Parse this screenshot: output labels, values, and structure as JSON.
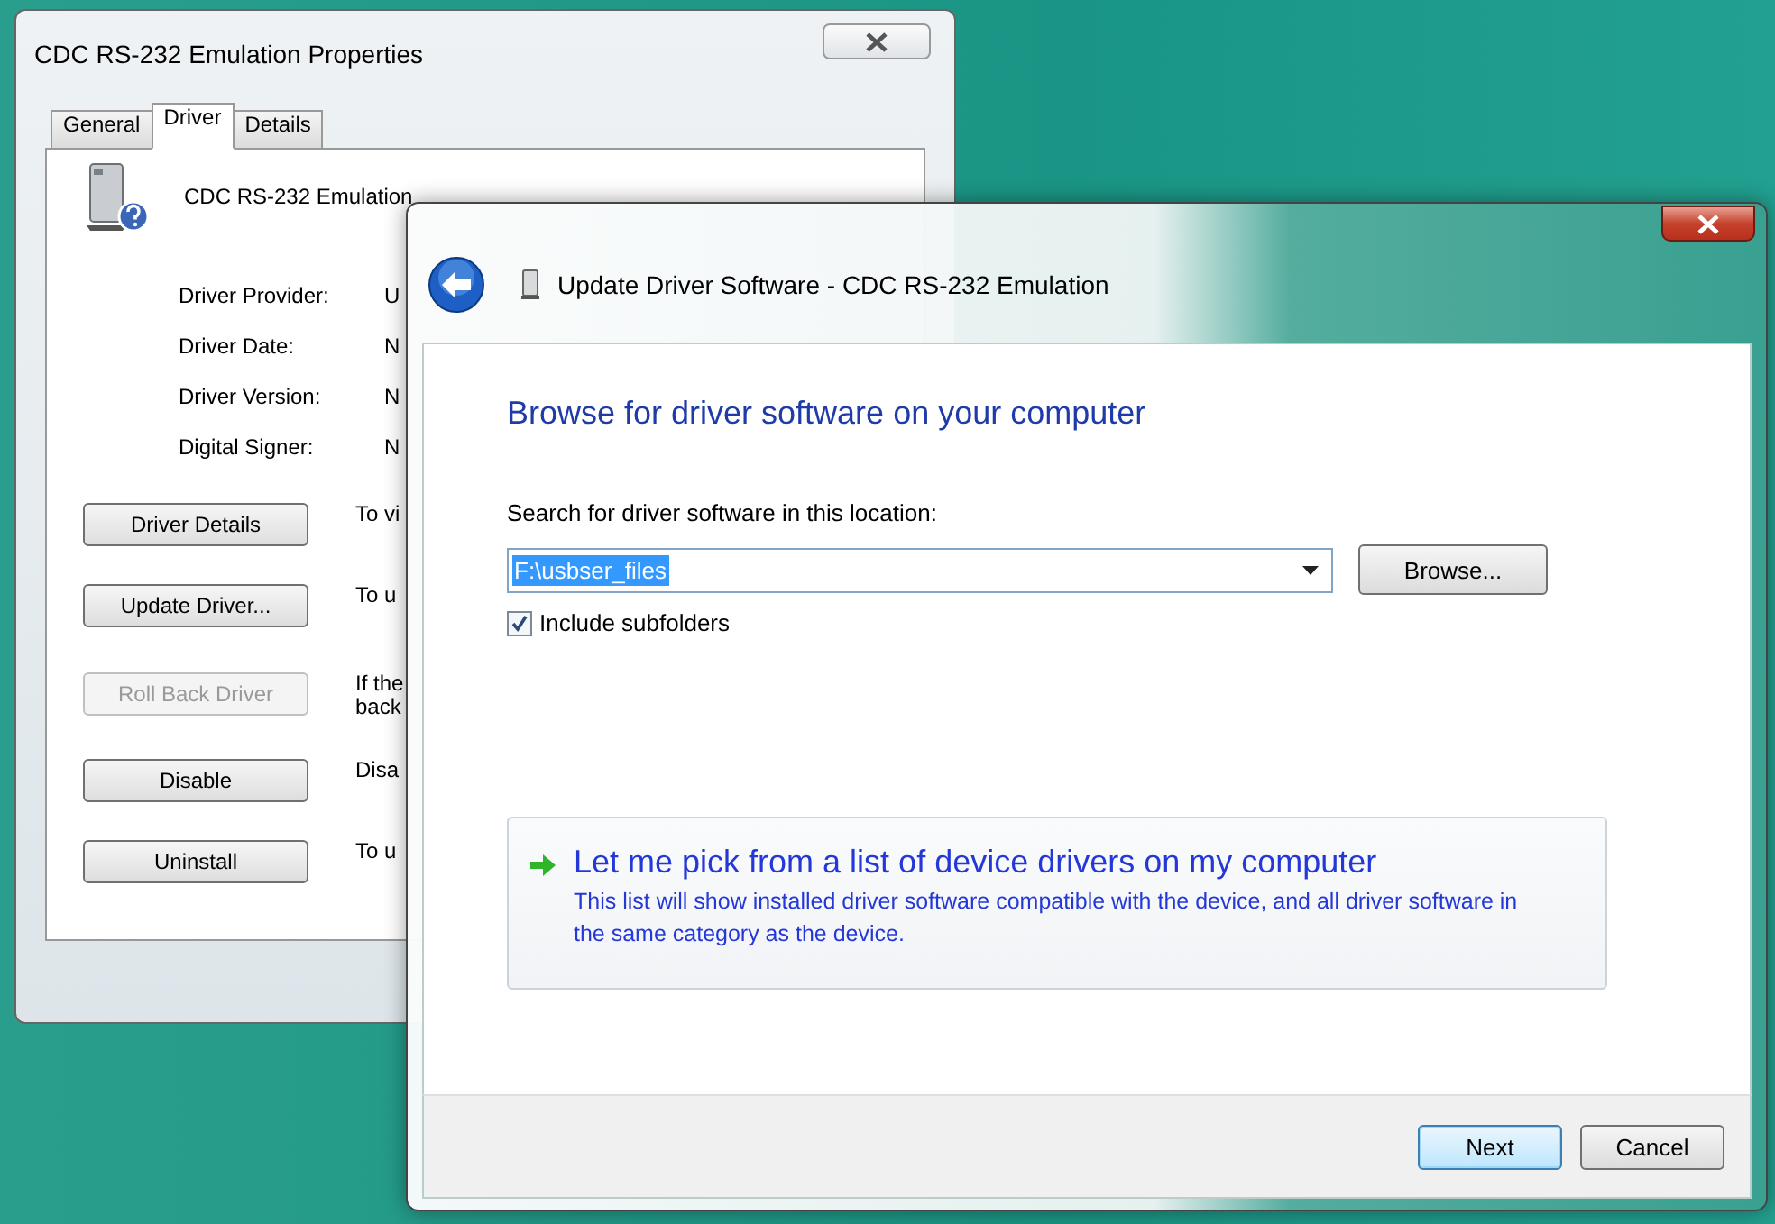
{
  "properties_window": {
    "title": "CDC RS-232 Emulation Properties",
    "tabs": [
      {
        "label": "General",
        "selected": false
      },
      {
        "label": "Driver",
        "selected": true
      },
      {
        "label": "Details",
        "selected": false
      }
    ],
    "device_name": "CDC RS-232 Emulation",
    "fields": [
      {
        "label": "Driver Provider:",
        "value": "U"
      },
      {
        "label": "Driver Date:",
        "value": "N"
      },
      {
        "label": "Driver Version:",
        "value": "N"
      },
      {
        "label": "Digital Signer:",
        "value": "N"
      }
    ],
    "actions": [
      {
        "button": "Driver Details",
        "disabled": false,
        "description_lines": [
          "To vi"
        ]
      },
      {
        "button": "Update Driver...",
        "disabled": false,
        "description_lines": [
          "To u"
        ]
      },
      {
        "button": "Roll Back Driver",
        "disabled": true,
        "description_lines": [
          "If the",
          "back"
        ]
      },
      {
        "button": "Disable",
        "disabled": false,
        "description_lines": [
          "Disa"
        ]
      },
      {
        "button": "Uninstall",
        "disabled": false,
        "description_lines": [
          "To u"
        ]
      }
    ]
  },
  "update_dialog": {
    "title": "Update Driver Software - CDC RS-232 Emulation",
    "heading": "Browse for driver software on your computer",
    "location_label": "Search for driver software in this location:",
    "location": {
      "value": "F:\\usbser_files",
      "highlighted": true
    },
    "browse": "Browse...",
    "include_subfolders": {
      "label": "Include subfolders",
      "checked": true
    },
    "pick_option": {
      "title": "Let me pick from a list of device drivers on my computer",
      "description": "This list will show installed driver software compatible with the device, and all driver software in the same category as the device."
    },
    "buttons": [
      {
        "label": "Next",
        "default": true
      },
      {
        "label": "Cancel",
        "default": false
      }
    ]
  }
}
